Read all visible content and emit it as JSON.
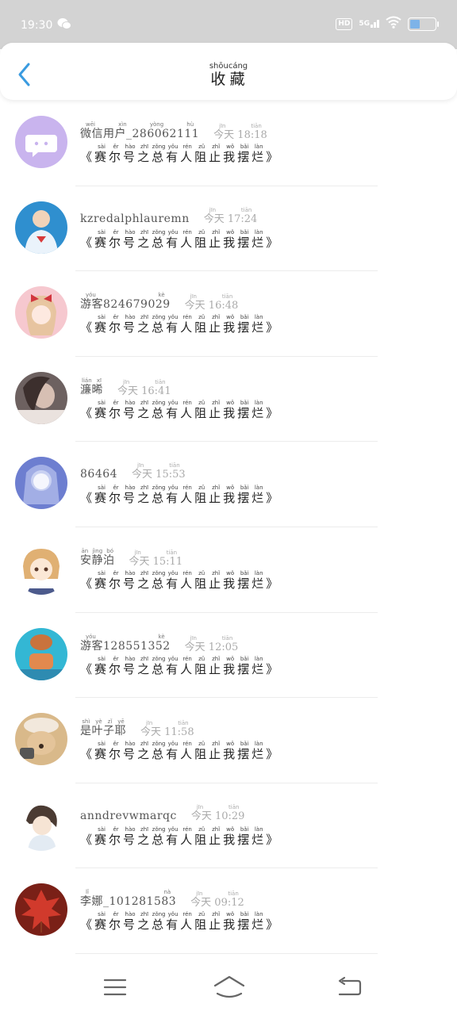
{
  "status_bar": {
    "time": "19:30",
    "network_label": "5G",
    "hd_label": "HD",
    "icons": [
      "wechat-icon",
      "hd-icon",
      "signal-icon",
      "wifi-icon",
      "battery-icon"
    ]
  },
  "header": {
    "title": "收藏",
    "title_pinyin": "shōucáng",
    "back_icon": "chevron-left-icon",
    "accent": "#3a9be0"
  },
  "list": {
    "items": [
      {
        "user": "微信用户_286062111",
        "user_pinyin": "wēi xìn yòng hù",
        "time": "今天 18:18",
        "title": "《赛尔号之总有人阻止我摆烂》",
        "avatar_color": "#c9b4ee"
      },
      {
        "user": "kzredalphlauremn",
        "user_pinyin": "",
        "time": "今天 17:24",
        "title": "《赛尔号之总有人阻止我摆烂》",
        "avatar_color": "#2f8fcf"
      },
      {
        "user": "游客824679029",
        "user_pinyin": "yóu kè",
        "time": "今天 16:48",
        "title": "《赛尔号之总有人阻止我摆烂》",
        "avatar_color": "#f6c8cf"
      },
      {
        "user": "濂晞",
        "user_pinyin": "lián xī",
        "time": "今天 16:41",
        "title": "《赛尔号之总有人阻止我摆烂》",
        "avatar_color": "#6d6160"
      },
      {
        "user": "86464",
        "user_pinyin": "",
        "time": "今天 15:53",
        "title": "《赛尔号之总有人阻止我摆烂》",
        "avatar_color": "#6d7ed0"
      },
      {
        "user": "安静泊",
        "user_pinyin": "ān jìng bó",
        "time": "今天 15:11",
        "title": "《赛尔号之总有人阻止我摆烂》",
        "avatar_color": "#f2dcb7"
      },
      {
        "user": "游客128551352",
        "user_pinyin": "yóu kè",
        "time": "今天 12:05",
        "title": "《赛尔号之总有人阻止我摆烂》",
        "avatar_color": "#33b7d4"
      },
      {
        "user": "是叶子耶",
        "user_pinyin": "shì yè zǐ yē",
        "time": "今天 11:58",
        "title": "《赛尔号之总有人阻止我摆烂》",
        "avatar_color": "#d9b98a"
      },
      {
        "user": "anndrevwmarqc",
        "user_pinyin": "",
        "time": "今天 10:29",
        "title": "《赛尔号之总有人阻止我摆烂》",
        "avatar_color": "#d8c7b3"
      },
      {
        "user": "李娜_101281583",
        "user_pinyin": "lǐ nà",
        "time": "今天 09:12",
        "title": "《赛尔号之总有人阻止我摆烂》",
        "avatar_color": "#d13a2c"
      }
    ],
    "time_pinyin": "jīn tiān",
    "title_pinyin": [
      "",
      "sài",
      "ěr",
      "hào",
      "zhī",
      "zǒng",
      "yǒu",
      "rén",
      "zǔ",
      "zhǐ",
      "wǒ",
      "bǎi",
      "làn",
      ""
    ]
  },
  "nav_bar": {
    "icons": [
      "menu-icon",
      "home-icon",
      "back-icon"
    ]
  }
}
